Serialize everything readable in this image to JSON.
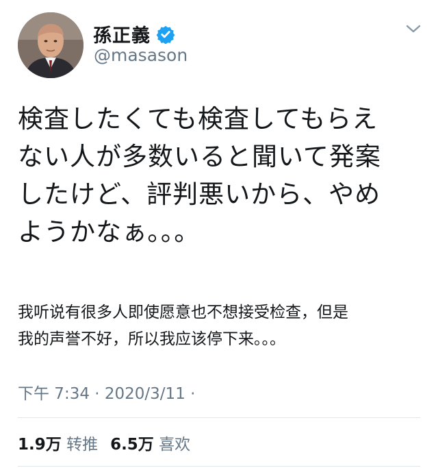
{
  "user": {
    "display_name": "孫正義",
    "handle": "@masason",
    "verified": true
  },
  "tweet": {
    "text": "検査したくても検査してもらえ\nない人が多数いると聞いて発案\nしたけど、評判悪いから、やめ\nようかなぁ。。。",
    "translation": "我听说有很多人即使愿意也不想接受检查，但是\n我的声誉不好，所以我应该停下来。。。",
    "timestamp": "下午 7:34 · 2020/3/11 ·"
  },
  "stats": {
    "retweets_count": "1.9万",
    "retweets_label": "转推",
    "likes_count": "6.5万",
    "likes_label": "喜欢"
  },
  "colors": {
    "verified": "#1da1f2",
    "secondary_text": "#657786",
    "divider": "#e1e8ed"
  },
  "icons": {
    "verified": "verified-badge-icon",
    "menu": "chevron-down-icon"
  }
}
